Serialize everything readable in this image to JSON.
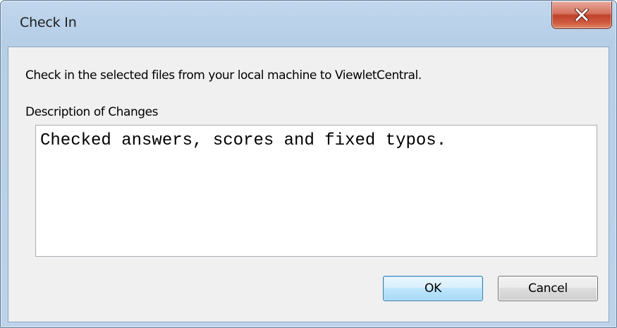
{
  "window": {
    "title": "Check In",
    "close_icon": "close-x-icon"
  },
  "dialog": {
    "instruction": "Check in the selected files from your local machine to ViewletCentral.",
    "description_label": "Description of Changes",
    "description_value": "Checked answers, scores and fixed typos."
  },
  "buttons": {
    "ok_label": "OK",
    "cancel_label": "Cancel"
  },
  "colors": {
    "titlebar": "#bad2ea",
    "close_button": "#c0422b",
    "client_background": "#f0f0f0",
    "default_button_border": "#3c7fb1"
  }
}
